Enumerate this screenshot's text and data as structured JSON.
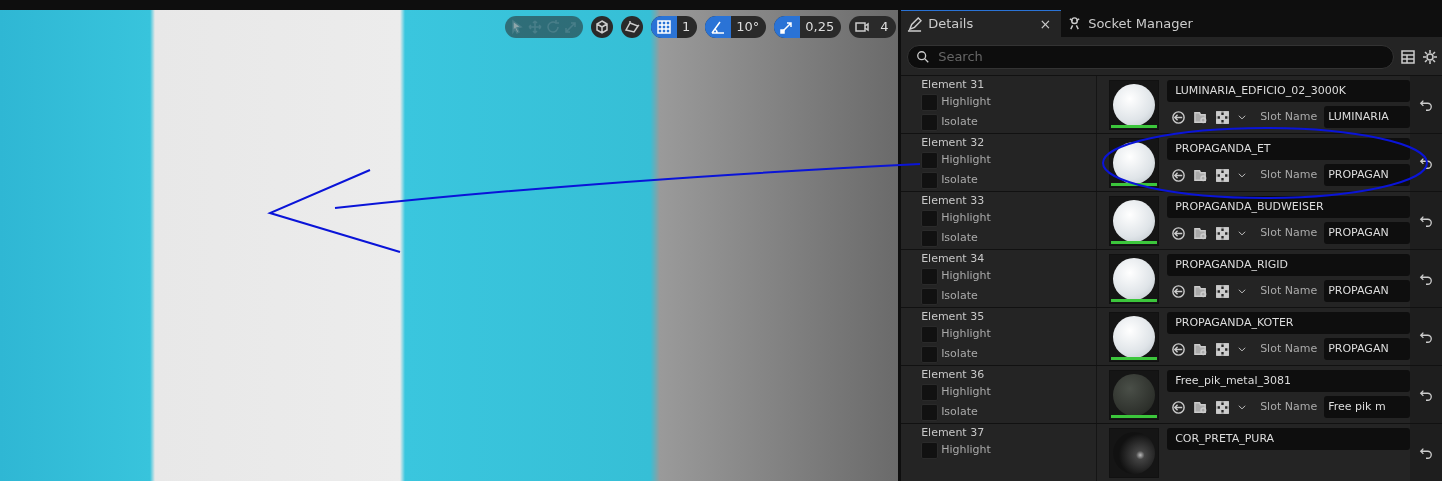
{
  "viewport": {
    "toolbar": {
      "transform_tools": [
        {
          "kind": "select",
          "disabled": true
        },
        {
          "kind": "move",
          "disabled": true
        },
        {
          "kind": "rotate",
          "disabled": true
        },
        {
          "kind": "scale",
          "disabled": true
        }
      ],
      "toggles": [
        {
          "kind": "world"
        },
        {
          "kind": "surface"
        }
      ],
      "snaps": [
        {
          "kind": "grid",
          "on": true,
          "value": "1"
        },
        {
          "kind": "angle",
          "on": true,
          "value": "10°"
        },
        {
          "kind": "scale",
          "on": true,
          "value": "0,25"
        },
        {
          "kind": "camera",
          "on": false,
          "value": "4"
        }
      ]
    }
  },
  "details": {
    "tabs": [
      {
        "label": "Details",
        "selected": true,
        "close": "×"
      },
      {
        "label": "Socket Manager",
        "selected": false
      }
    ],
    "search": {
      "placeholder": "Search"
    },
    "elements": [
      {
        "label": "Element 31",
        "material": "LUMINARIA_EDFICIO_02_3000K",
        "kind": "white",
        "slot_label": "Slot Name",
        "slot_value": "LUMINARIA",
        "highlight": {
          "label": "Highlight",
          "checked": false
        },
        "isolate": {
          "label": "Isolate",
          "checked": false
        }
      },
      {
        "label": "Element 32",
        "material": "PROPAGANDA_ET",
        "kind": "white",
        "slot_label": "Slot Name",
        "slot_value": "PROPAGAN",
        "highlight": {
          "label": "Highlight",
          "checked": false
        },
        "isolate": {
          "label": "Isolate",
          "checked": false
        }
      },
      {
        "label": "Element 33",
        "material": "PROPAGANDA_BUDWEISER",
        "kind": "white",
        "slot_label": "Slot Name",
        "slot_value": "PROPAGAN",
        "highlight": {
          "label": "Highlight",
          "checked": false
        },
        "isolate": {
          "label": "Isolate",
          "checked": false
        }
      },
      {
        "label": "Element 34",
        "material": "PROPAGANDA_RIGID",
        "kind": "white",
        "slot_label": "Slot Name",
        "slot_value": "PROPAGAN",
        "highlight": {
          "label": "Highlight",
          "checked": false
        },
        "isolate": {
          "label": "Isolate",
          "checked": false
        }
      },
      {
        "label": "Element 35",
        "material": "PROPAGANDA_KOTER",
        "kind": "white",
        "slot_label": "Slot Name",
        "slot_value": "PROPAGAN",
        "highlight": {
          "label": "Highlight",
          "checked": false
        },
        "isolate": {
          "label": "Isolate",
          "checked": false
        }
      },
      {
        "label": "Element 36",
        "material": "Free_pik_metal_3081",
        "kind": "metal",
        "slot_label": "Slot Name",
        "slot_value": "Free pik m",
        "highlight": {
          "label": "Highlight",
          "checked": false
        },
        "isolate": {
          "label": "Isolate",
          "checked": false
        }
      },
      {
        "label": "Element 37",
        "material": "COR_PRETA_PURA",
        "kind": "black",
        "highlight": {
          "label": "Highlight",
          "checked": false
        }
      }
    ]
  }
}
